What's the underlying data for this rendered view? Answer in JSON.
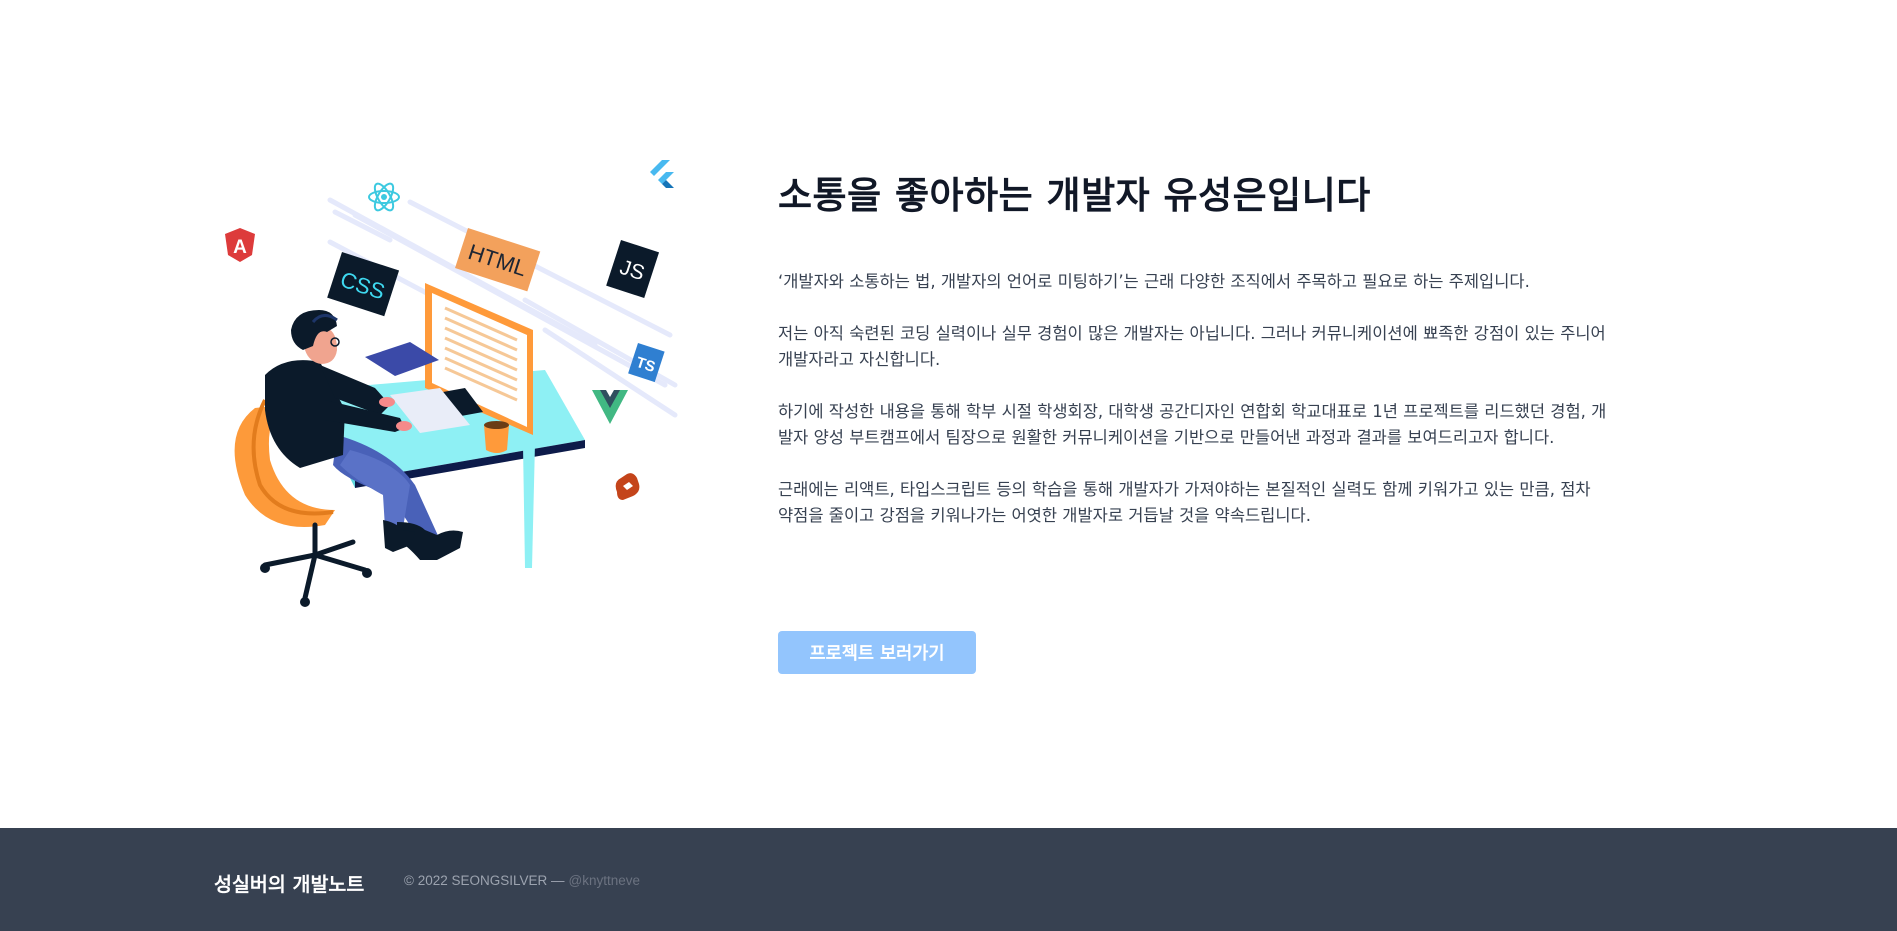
{
  "hero": {
    "title": "소통을 좋아하는 개발자 유성은입니다",
    "paragraphs": [
      "‘개발자와 소통하는 법, 개발자의 언어로 미팅하기’는 근래 다양한 조직에서 주목하고 필요로 하는 주제입니다.",
      "저는 아직 숙련된 코딩 실력이나 실무 경험이 많은 개발자는 아닙니다. 그러나 커뮤니케이션에 뾰족한 강점이 있는 주니어 개발자라고 자신합니다.",
      "하기에 작성한 내용을 통해 학부 시절 학생회장, 대학생 공간디자인 연합회 학교대표로 1년 프로젝트를 리드했던 경험, 개발자 양성 부트캠프에서 팀장으로 원활한 커뮤니케이션을 기반으로 만들어낸 과정과 결과를 보여드리고자 합니다.",
      "근래에는 리액트, 타입스크립트 등의 학습을 통해 개발자가 가져야하는 본질적인 실력도 함께 키워가고 있는 만큼, 점차 약점을 줄이고 강점을 키워나가는 어엿한 개발자로 거듭날 것을 약속드립니다."
    ],
    "cta_label": "프로젝트 보러가기",
    "illustration": {
      "badges": [
        "HTML",
        "CSS",
        "JS",
        "TS"
      ],
      "icons": [
        "react-icon",
        "angular-icon",
        "flutter-icon",
        "vue-icon",
        "svelte-icon"
      ]
    }
  },
  "footer": {
    "brand": "성실버의 개발노트",
    "copyright": "© 2022 SEONGSILVER —",
    "handle": "@knyttneve"
  },
  "colors": {
    "title": "#111827",
    "body_text": "#374151",
    "button": "#93c5fd",
    "footer_bg": "#374151",
    "footer_muted": "#9ca3af",
    "desk": "#8ef0f4",
    "chair": "#fd9a3a"
  }
}
